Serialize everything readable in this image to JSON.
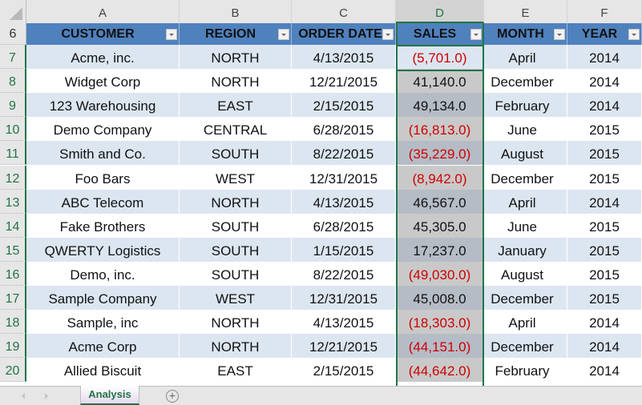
{
  "app": "Spreadsheet",
  "column_letters": [
    "A",
    "B",
    "C",
    "D",
    "E",
    "F"
  ],
  "selected_column": "D",
  "table": {
    "header_row_number": "6",
    "headers": [
      "CUSTOMER",
      "REGION",
      "ORDER DATE",
      "SALES",
      "MONTH",
      "YEAR"
    ],
    "rows": [
      {
        "row": "7",
        "customer": "Acme, inc.",
        "region": "NORTH",
        "order_date": "4/13/2015",
        "sales": "(5,701.0)",
        "negative": true,
        "month": "April",
        "year": "2014"
      },
      {
        "row": "8",
        "customer": "Widget Corp",
        "region": "NORTH",
        "order_date": "12/21/2015",
        "sales": "41,140.0",
        "negative": false,
        "month": "December",
        "year": "2014"
      },
      {
        "row": "9",
        "customer": "123 Warehousing",
        "region": "EAST",
        "order_date": "2/15/2015",
        "sales": "49,134.0",
        "negative": false,
        "month": "February",
        "year": "2014"
      },
      {
        "row": "10",
        "customer": "Demo Company",
        "region": "CENTRAL",
        "order_date": "6/28/2015",
        "sales": "(16,813.0)",
        "negative": true,
        "month": "June",
        "year": "2015"
      },
      {
        "row": "11",
        "customer": "Smith and Co.",
        "region": "SOUTH",
        "order_date": "8/22/2015",
        "sales": "(35,229.0)",
        "negative": true,
        "month": "August",
        "year": "2015"
      },
      {
        "row": "12",
        "customer": "Foo Bars",
        "region": "WEST",
        "order_date": "12/31/2015",
        "sales": "(8,942.0)",
        "negative": true,
        "month": "December",
        "year": "2015"
      },
      {
        "row": "13",
        "customer": "ABC Telecom",
        "region": "NORTH",
        "order_date": "4/13/2015",
        "sales": "46,567.0",
        "negative": false,
        "month": "April",
        "year": "2014"
      },
      {
        "row": "14",
        "customer": "Fake Brothers",
        "region": "SOUTH",
        "order_date": "6/28/2015",
        "sales": "45,305.0",
        "negative": false,
        "month": "June",
        "year": "2015"
      },
      {
        "row": "15",
        "customer": "QWERTY Logistics",
        "region": "SOUTH",
        "order_date": "1/15/2015",
        "sales": "17,237.0",
        "negative": false,
        "month": "January",
        "year": "2015"
      },
      {
        "row": "16",
        "customer": "Demo, inc.",
        "region": "SOUTH",
        "order_date": "8/22/2015",
        "sales": "(49,030.0)",
        "negative": true,
        "month": "August",
        "year": "2015"
      },
      {
        "row": "17",
        "customer": "Sample Company",
        "region": "WEST",
        "order_date": "12/31/2015",
        "sales": "45,008.0",
        "negative": false,
        "month": "December",
        "year": "2015"
      },
      {
        "row": "18",
        "customer": "Sample, inc",
        "region": "NORTH",
        "order_date": "4/13/2015",
        "sales": "(18,303.0)",
        "negative": true,
        "month": "April",
        "year": "2014"
      },
      {
        "row": "19",
        "customer": "Acme Corp",
        "region": "NORTH",
        "order_date": "12/21/2015",
        "sales": "(44,151.0)",
        "negative": true,
        "month": "December",
        "year": "2014"
      },
      {
        "row": "20",
        "customer": "Allied Biscuit",
        "region": "EAST",
        "order_date": "2/15/2015",
        "sales": "(44,642.0)",
        "negative": true,
        "month": "February",
        "year": "2014"
      }
    ]
  },
  "sheet_tabs": [
    {
      "label": "Analysis",
      "active": true
    }
  ],
  "add_sheet_label": "+",
  "colors": {
    "header_fill": "#4f81bd",
    "band_fill": "#dce6f1",
    "selection": "#217346",
    "negative_text": "#d00000"
  }
}
